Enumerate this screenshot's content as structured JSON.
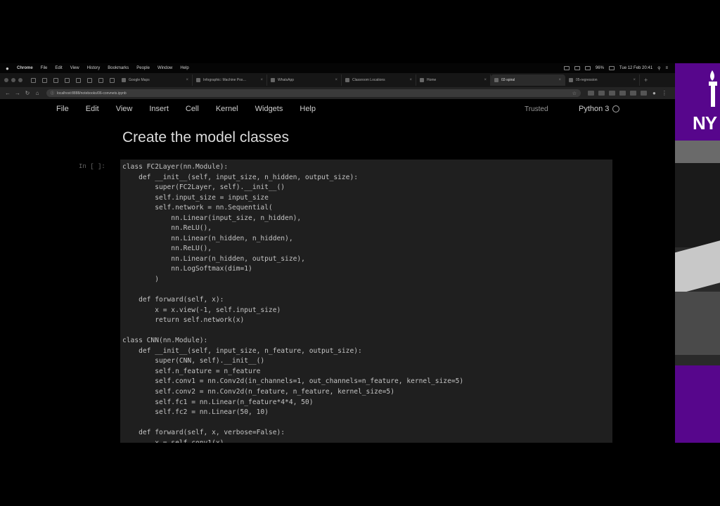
{
  "menubar": {
    "app": "Chrome",
    "items": [
      "File",
      "Edit",
      "View",
      "History",
      "Bookmarks",
      "People",
      "Window",
      "Help"
    ],
    "clock": "Tue 12 Feb 20:41",
    "battery": "96%"
  },
  "tabs": [
    {
      "label": "Google Maps",
      "active": false
    },
    {
      "label": "Infographic: Machine Pos…",
      "active": false
    },
    {
      "label": "WhatsApp",
      "active": false
    },
    {
      "label": "Classroom Locations",
      "active": false
    },
    {
      "label": "Home",
      "active": false
    },
    {
      "label": "02-spiral",
      "active": false
    },
    {
      "label": "05-regression",
      "active": false
    }
  ],
  "address": {
    "url": "localhost:8888/notebooks/06-convnets.ipynb"
  },
  "jupyter": {
    "menu": [
      "File",
      "Edit",
      "View",
      "Insert",
      "Cell",
      "Kernel",
      "Widgets",
      "Help"
    ],
    "trusted": "Trusted",
    "kernel": "Python 3"
  },
  "heading": "Create the model classes",
  "cell": {
    "prompt": "In [ ]:",
    "code_lines": [
      "class FC2Layer(nn.Module):",
      "    def __init__(self, input_size, n_hidden, output_size):",
      "        super(FC2Layer, self).__init__()",
      "        self.input_size = input_size",
      "        self.network = nn.Sequential(",
      "            nn.Linear(input_size, n_hidden),",
      "            nn.ReLU(),",
      "            nn.Linear(n_hidden, n_hidden),",
      "            nn.ReLU(),",
      "            nn.Linear(n_hidden, output_size),",
      "            nn.LogSoftmax(dim=1)",
      "        )",
      "",
      "    def forward(self, x):",
      "        x = x.view(-1, self.input_size)",
      "        return self.network(x)",
      "",
      "class CNN(nn.Module):",
      "    def __init__(self, input_size, n_feature, output_size):",
      "        super(CNN, self).__init__()",
      "        self.n_feature = n_feature",
      "        self.conv1 = nn.Conv2d(in_channels=1, out_channels=n_feature, kernel_size=5)",
      "        self.conv2 = nn.Conv2d(n_feature, n_feature, kernel_size=5)",
      "        self.fc1 = nn.Linear(n_feature*4*4, 50)",
      "        self.fc2 = nn.Linear(50, 10)",
      "",
      "    def forward(self, x, verbose=False):",
      "        x = self.conv1(x)"
    ]
  },
  "side": {
    "logo_text": "NY"
  },
  "colors": {
    "nyu_purple": "#57068c",
    "cell_bg": "#1f1f1f"
  }
}
